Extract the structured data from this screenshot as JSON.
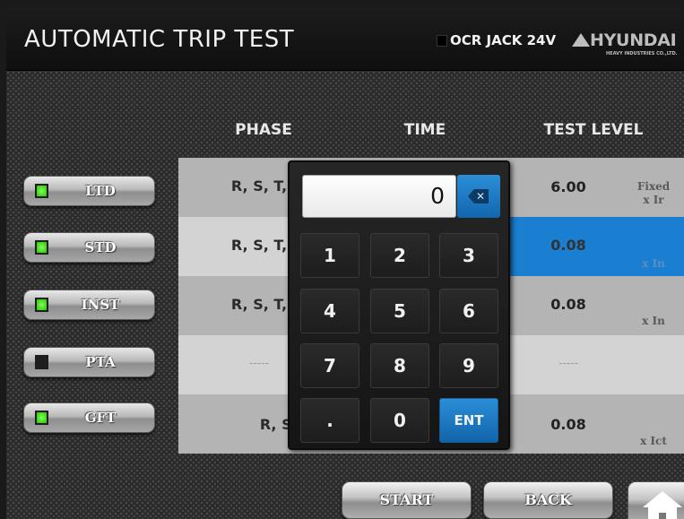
{
  "header": {
    "title": "AUTOMATIC TRIP TEST",
    "ocr_label": "OCR JACK 24V",
    "brand": "HYUNDAI",
    "brand_sub": "HEAVY INDUSTRIES CO.,LTD."
  },
  "columns": {
    "phase": "PHASE",
    "time": "TIME",
    "test_level": "TEST LEVEL"
  },
  "side_buttons": [
    {
      "label": "LTD",
      "led": "on"
    },
    {
      "label": "STD",
      "led": "on"
    },
    {
      "label": "INST",
      "led": "on"
    },
    {
      "label": "PTA",
      "led": "off"
    },
    {
      "label": "GFT",
      "led": "on"
    }
  ],
  "rows": [
    {
      "phase": "R, S, T,",
      "level": "6.00",
      "unit_top": "Fixed",
      "unit": "x Ir"
    },
    {
      "phase": "R, S, T,",
      "level": "0.08",
      "unit_top": "",
      "unit": "x In"
    },
    {
      "phase": "R, S, T,",
      "level": "0.08",
      "unit_top": "",
      "unit": "x In"
    },
    {
      "phase": "-----",
      "level": "-----",
      "unit_top": "",
      "unit": ""
    },
    {
      "phase": "R, S, T",
      "level": "0.08",
      "unit_top": "",
      "unit": "x Ict"
    }
  ],
  "keypad": {
    "display_value": "0",
    "keys": [
      "1",
      "2",
      "3",
      "4",
      "5",
      "6",
      "7",
      "8",
      "9",
      ".",
      "0",
      "ENT"
    ]
  },
  "footer": {
    "start": "START",
    "back": "BACK"
  },
  "colors": {
    "accent_blue": "#1a7fd0",
    "led_green": "#3fe01a"
  }
}
